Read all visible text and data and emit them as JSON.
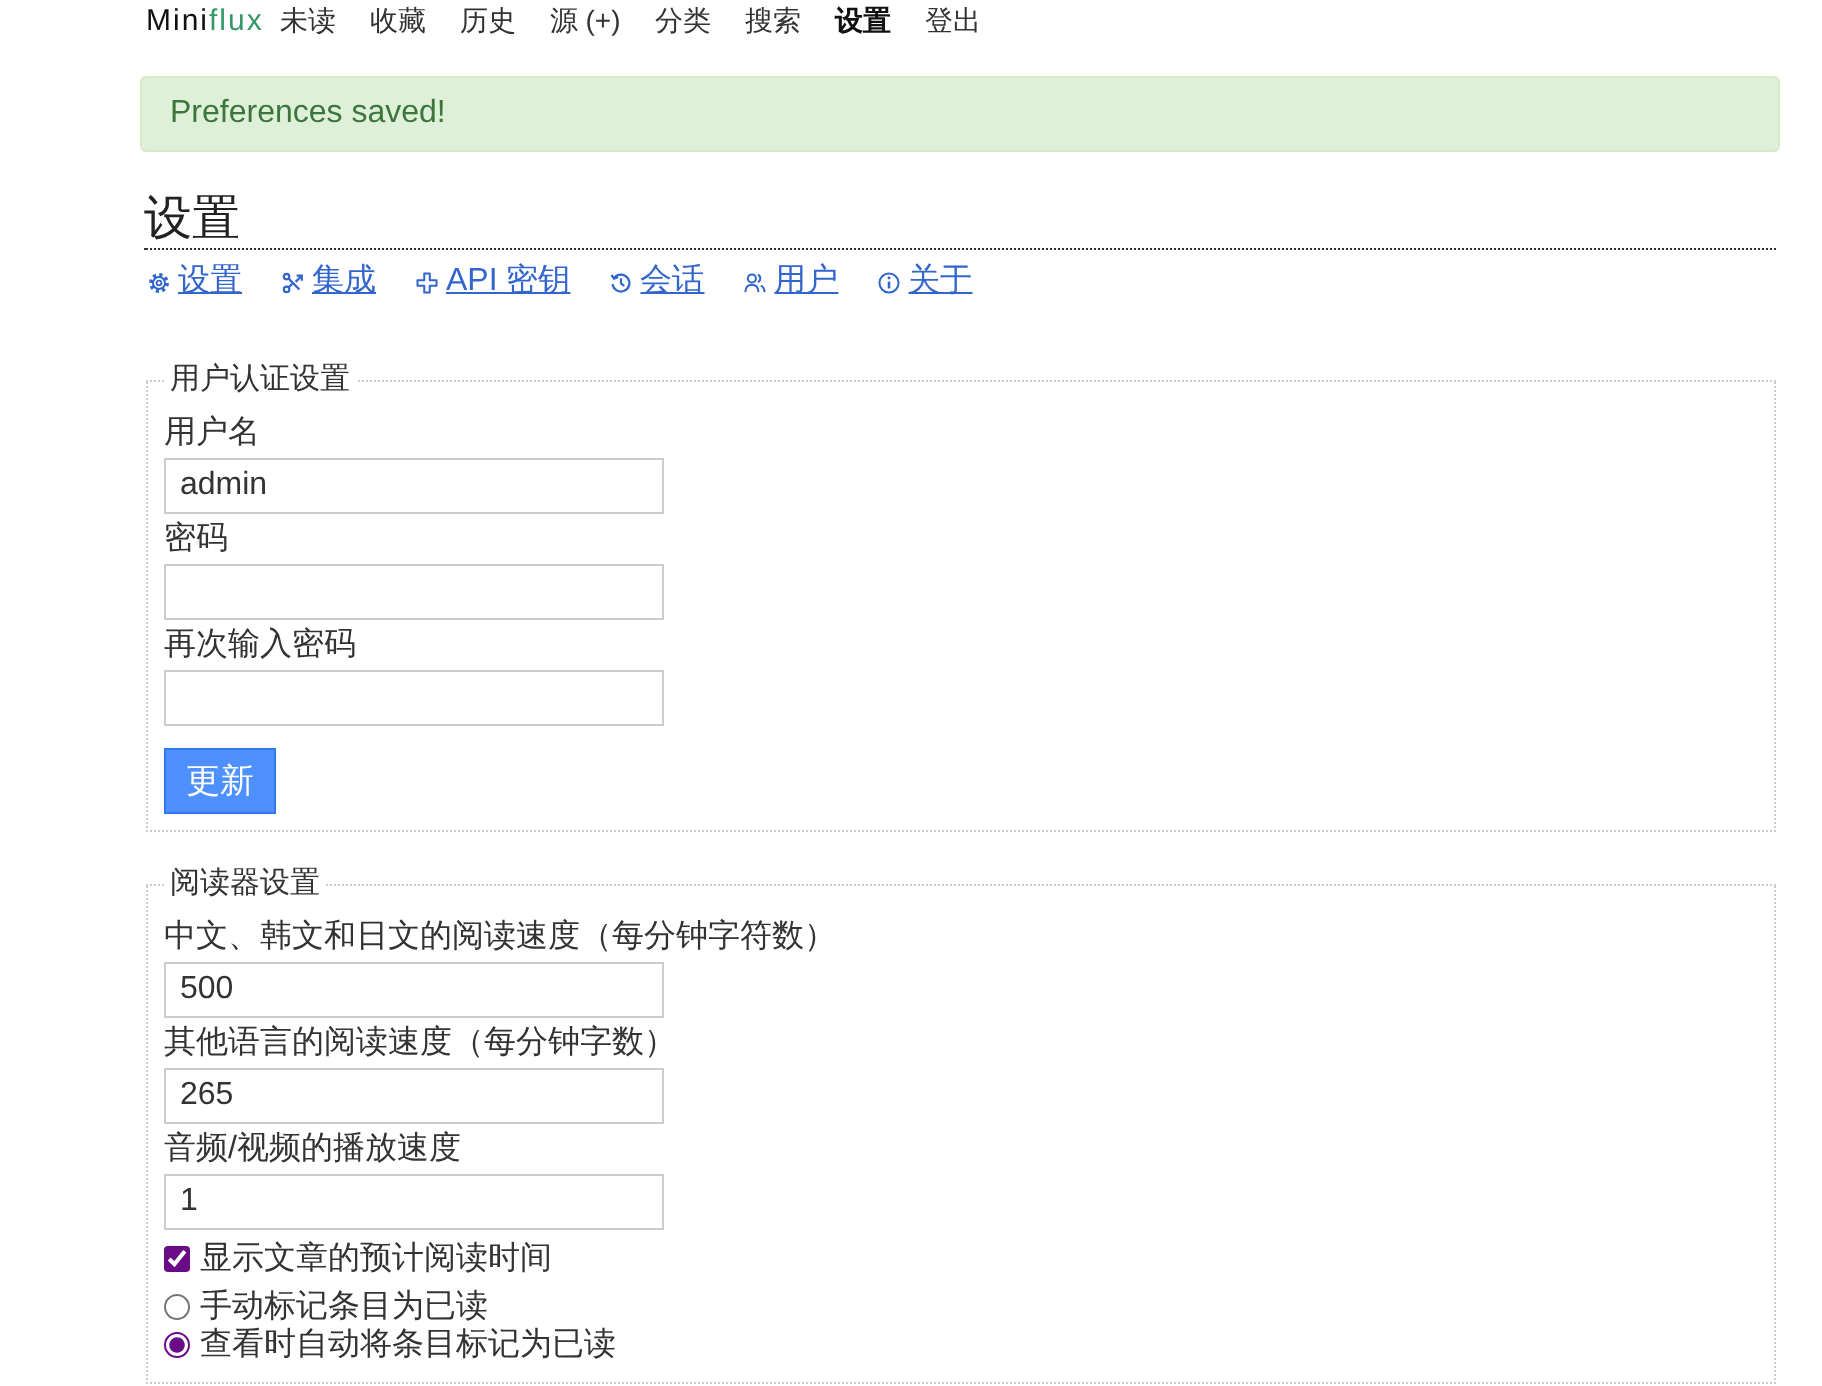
{
  "nav": {
    "logo_prefix": "Mini",
    "logo_suffix": "flux",
    "items": [
      {
        "label": "未读",
        "selected": false
      },
      {
        "label": "收藏",
        "selected": false
      },
      {
        "label": "历史",
        "selected": false
      },
      {
        "label": "源 (+)",
        "selected": false
      },
      {
        "label": "分类",
        "selected": false
      },
      {
        "label": "搜索",
        "selected": false
      },
      {
        "label": "设置",
        "selected": true
      },
      {
        "label": "登出",
        "selected": false
      }
    ]
  },
  "alert": {
    "message": "Preferences saved!"
  },
  "page": {
    "title": "设置",
    "tabs": [
      {
        "label": "设置",
        "kind": "gear"
      },
      {
        "label": "集成",
        "kind": "nodes"
      },
      {
        "label": "API 密钥",
        "kind": "plus"
      },
      {
        "label": "会话",
        "kind": "history"
      },
      {
        "label": "用户",
        "kind": "users"
      },
      {
        "label": "关于",
        "kind": "info"
      }
    ]
  },
  "sections": [
    {
      "legend": "用户认证设置",
      "fields": [
        {
          "kind": "text",
          "label": "用户名",
          "value": "admin"
        },
        {
          "kind": "password",
          "label": "密码"
        },
        {
          "kind": "password",
          "label": "再次输入密码"
        }
      ],
      "button": "更新"
    },
    {
      "legend": "阅读器设置",
      "fields": [
        {
          "kind": "text",
          "label": "中文、韩文和日文的阅读速度（每分钟字符数）",
          "value": "500"
        },
        {
          "kind": "text",
          "label": "其他语言的阅读速度（每分钟字数）",
          "value": "265"
        },
        {
          "kind": "text",
          "label": "音频/视频的播放速度",
          "value": "1"
        },
        {
          "kind": "checkbox",
          "label": "显示文章的预计阅读时间",
          "checked": true
        },
        {
          "kind": "radio",
          "label": "手动标记条目为已读",
          "selected": false
        },
        {
          "kind": "radio",
          "label": "查看时自动将条目标记为已读",
          "selected": true
        }
      ]
    }
  ]
}
